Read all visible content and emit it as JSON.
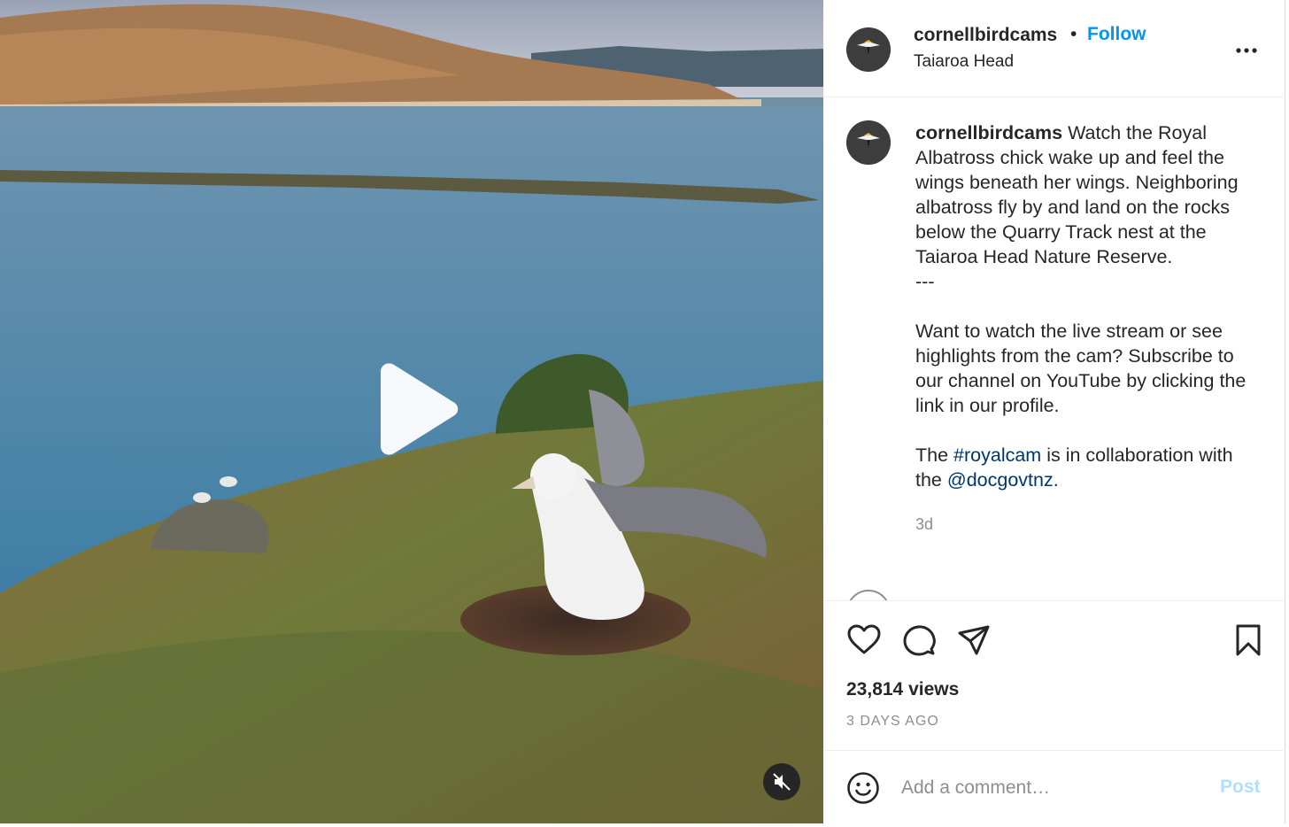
{
  "post": {
    "username": "cornellbirdcams",
    "separator": "•",
    "follow_label": "Follow",
    "location": "Taiaroa Head",
    "caption": {
      "username": "cornellbirdcams",
      "text_part1": " Watch the Royal Albatross chick wake up and feel the wings beneath her wings. Neighboring albatross fly by and land on the rocks below the Quarry Track nest at the Taiaroa Head Nature Reserve.\n---\n\nWant to watch the live stream or see highlights from the cam? Subscribe to our channel on YouTube by clicking the link in our profile.\n\nThe ",
      "hashtag": "#royalcam",
      "text_part2": " is in collaboration with the ",
      "mention": "@docgovtnz",
      "text_part3": ".",
      "time": "3d"
    },
    "views": "23,814 views",
    "posted_ago": "3 DAYS AGO",
    "comment_placeholder": "Add a comment…",
    "post_label": "Post"
  },
  "icons": {
    "more": "more-options-icon",
    "like": "heart-icon",
    "comment": "comment-bubble-icon",
    "share": "paper-plane-icon",
    "save": "bookmark-icon",
    "emoji": "smiley-icon",
    "play": "play-icon",
    "mute": "muted-speaker-icon"
  },
  "colors": {
    "accent": "#0095f6",
    "link": "#00376b",
    "muted_text": "#8e8e8e",
    "post_disabled": "#b2dffc"
  }
}
